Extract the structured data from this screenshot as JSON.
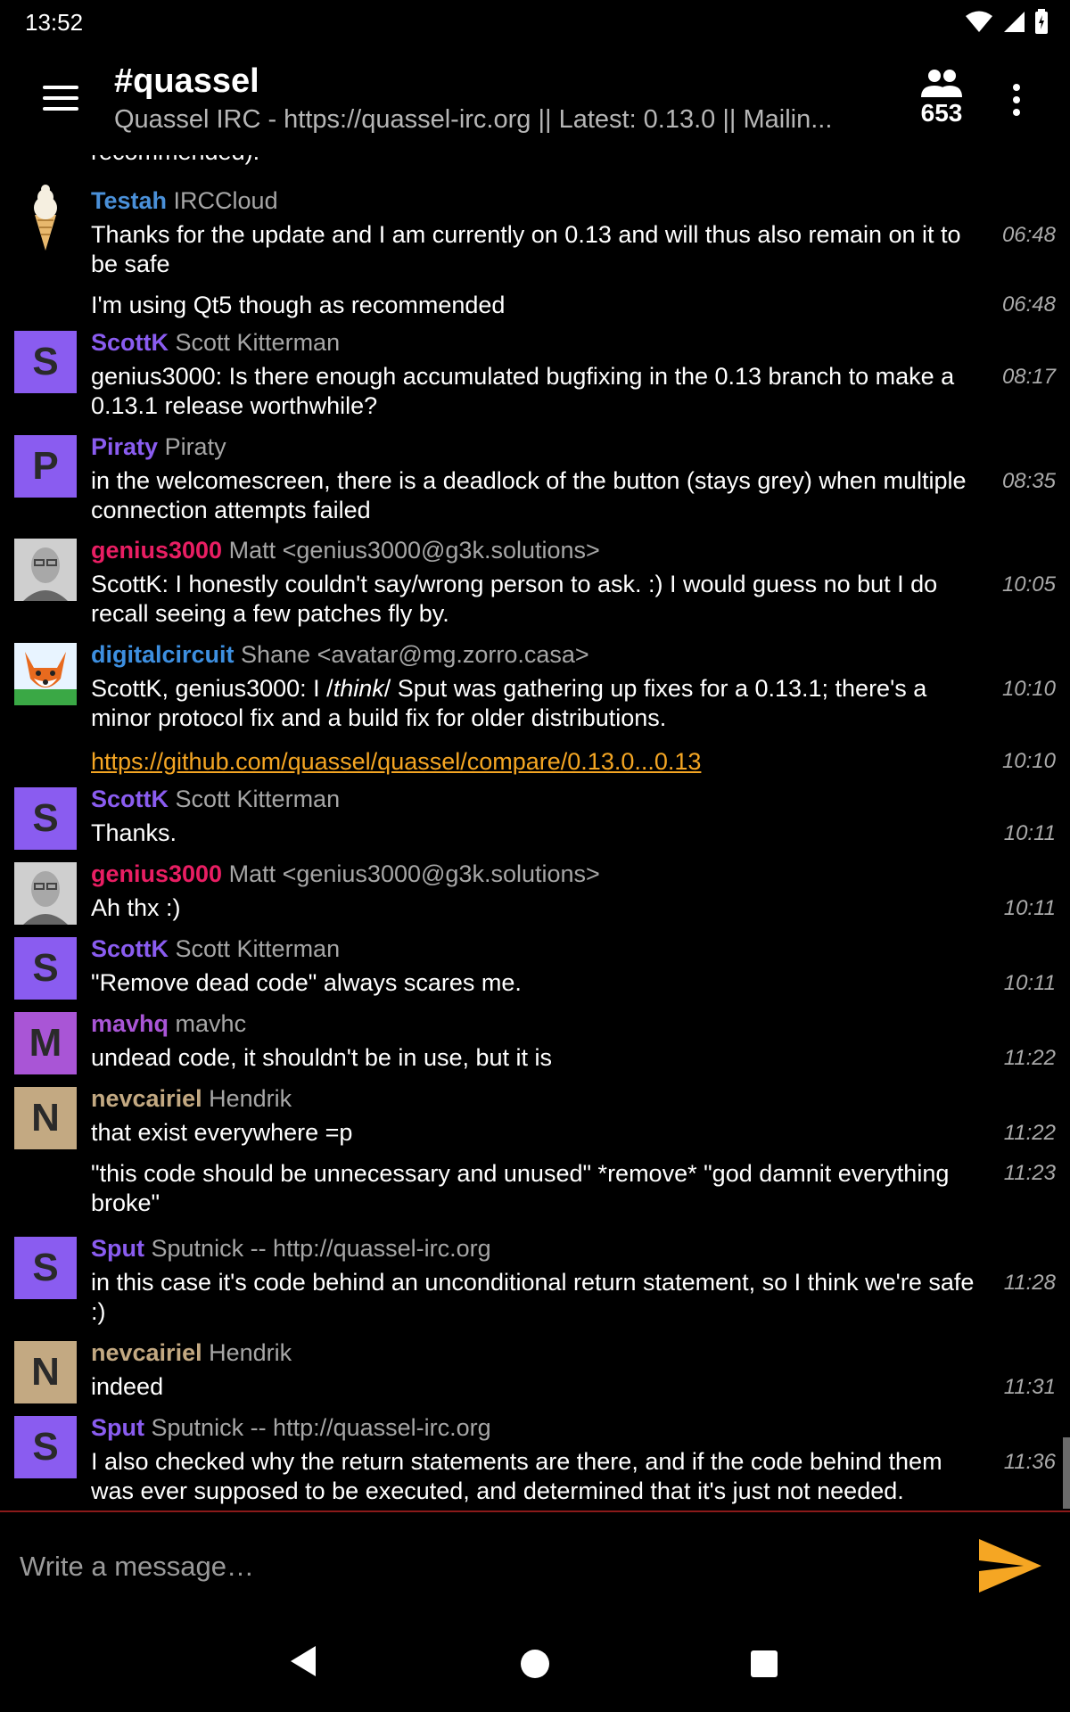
{
  "status_bar": {
    "time": "13:52"
  },
  "header": {
    "channel": "#quassel",
    "topic": "Quassel IRC - https://quassel-irc.org || Latest: 0.13.0 || Mailin...",
    "user_count": "653"
  },
  "messages": {
    "m0": {
      "text": "recommended)."
    },
    "m1": {
      "nick": "Testah",
      "realname": "IRCCloud",
      "text": "Thanks for the update and I am currently on 0.13 and will thus also remain on it to be safe",
      "time": "06:48"
    },
    "m2": {
      "text": "I'm using Qt5 though as recommended",
      "time": "06:48"
    },
    "m3": {
      "avatar": "S",
      "nick": "ScottK",
      "realname": "Scott Kitterman",
      "text": "genius3000: Is there enough accumulated bugfixing in the 0.13 branch to make a 0.13.1 release worthwhile?",
      "time": "08:17"
    },
    "m4": {
      "avatar": "P",
      "nick": "Piraty",
      "realname": "Piraty",
      "text": "in the welcomescreen, there is a deadlock of the button (stays grey) when multiple connection attempts failed",
      "time": "08:35"
    },
    "m5": {
      "nick": "genius3000",
      "realname": "Matt <genius3000@g3k.solutions>",
      "text": "ScottK: I honestly couldn't say/wrong person to ask. :)   I would guess no but I do recall seeing a few patches fly by.",
      "time": "10:05"
    },
    "m6": {
      "nick": "digitalcircuit",
      "realname": "Shane <avatar@mg.zorro.casa>",
      "text_pre": "ScottK, genius3000: I /",
      "text_em": "think",
      "text_post": "/ Sput was gathering up fixes for a 0.13.1; there's a minor protocol fix and a build fix for older distributions.",
      "time": "10:10"
    },
    "m7": {
      "link": "https://github.com/quassel/quassel/compare/0.13.0...0.13",
      "time": "10:10"
    },
    "m8": {
      "avatar": "S",
      "nick": "ScottK",
      "realname": "Scott Kitterman",
      "text": "Thanks.",
      "time": "10:11"
    },
    "m9": {
      "nick": "genius3000",
      "realname": "Matt <genius3000@g3k.solutions>",
      "text": "Ah thx :)",
      "time": "10:11"
    },
    "m10": {
      "avatar": "S",
      "nick": "ScottK",
      "realname": "Scott Kitterman",
      "text": "\"Remove dead code\" always scares me.",
      "time": "10:11"
    },
    "m11": {
      "avatar": "M",
      "nick": "mavhq",
      "realname": "mavhc",
      "text": "undead code, it shouldn't be in use, but it is",
      "time": "11:22"
    },
    "m12": {
      "avatar": "N",
      "nick": "nevcairiel",
      "realname": "Hendrik",
      "text": "that exist everywhere =p",
      "time": "11:22"
    },
    "m13": {
      "text": "\"this code should be unnecessary and unused\" *remove* \"god damnit everything broke\"",
      "time": "11:23"
    },
    "m14": {
      "avatar": "S",
      "nick": "Sput",
      "realname": "Sputnick -- http://quassel-irc.org",
      "text": "in this case it's code behind an unconditional return statement, so I think we're safe :)",
      "time": "11:28"
    },
    "m15": {
      "avatar": "N",
      "nick": "nevcairiel",
      "realname": "Hendrik",
      "text": "indeed",
      "time": "11:31"
    },
    "m16": {
      "avatar": "S",
      "nick": "Sput",
      "realname": "Sputnick -- http://quassel-irc.org",
      "text": "I also checked why the return statements are there, and if the code behind them was ever supposed to be executed, and determined that it's just not needed.",
      "time": "11:36"
    }
  },
  "composer": {
    "placeholder": "Write a message…"
  },
  "colors": {
    "accent": "#f5a623",
    "nick_testah": "#4a90d9",
    "nick_scottk": "#8a5cf0",
    "nick_piraty": "#8a5cf0",
    "nick_genius3000": "#e91e63",
    "nick_digitalcircuit": "#3d8fe0",
    "nick_mavhq": "#a955d6",
    "nick_nevcairiel": "#c3a982",
    "nick_sput": "#8a5cf0"
  }
}
